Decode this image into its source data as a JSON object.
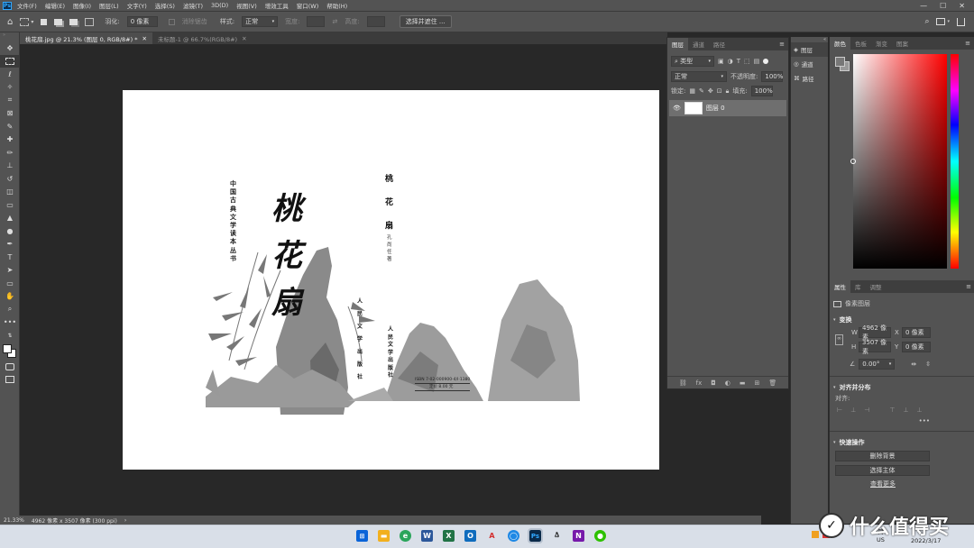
{
  "app": {
    "logo": "Ps"
  },
  "menu": [
    "文件(F)",
    "编辑(E)",
    "图像(I)",
    "图层(L)",
    "文字(Y)",
    "选择(S)",
    "滤镜(T)",
    "3D(D)",
    "视图(V)",
    "增效工具",
    "窗口(W)",
    "帮助(H)"
  ],
  "options": {
    "feather_label": "羽化:",
    "feather_value": "0 像素",
    "antialias_label": "消除锯齿",
    "style_label": "样式:",
    "style_value": "正常",
    "width_label": "宽度:",
    "height_label": "高度:",
    "select_mask_btn": "选择并遮住 ..."
  },
  "tabs": [
    {
      "label": "桃花扇.jpg @ 21.3% (图层 0, RGB/8#) *"
    },
    {
      "label": "未标题-1 @ 66.7%(RGB/8#)"
    }
  ],
  "document": {
    "series": "中国古典文学读本丛书",
    "title_calligraphy": [
      "桃",
      "花",
      "扇"
    ],
    "title_small": [
      "桃",
      "花",
      "扇"
    ],
    "author": "孔尚任著",
    "publisher_v1": "人民文学出版社",
    "publisher_v2": "人民文学出版社",
    "isbn": "ISBN 7-02-000900-4/I·1380",
    "price": "定价 8.00 元"
  },
  "status": {
    "zoom": "21.33%",
    "info": "4962 像素 x 3507 像素 (300 ppi)"
  },
  "layers_panel": {
    "tabs": [
      "图层",
      "通道",
      "路径"
    ],
    "kind_label": "类型",
    "blend_mode": "正常",
    "opacity_label": "不透明度:",
    "opacity_value": "100%",
    "lock_label": "锁定:",
    "fill_label": "填充:",
    "fill_value": "100%",
    "layer_name": "图层 0"
  },
  "dock_buttons": [
    "图层",
    "通道",
    "路径"
  ],
  "color_panel": {
    "tabs": [
      "颜色",
      "色板",
      "渐变",
      "图案"
    ]
  },
  "properties_panel": {
    "tabs": [
      "属性",
      "库",
      "调整"
    ],
    "kind": "像素图层",
    "transform_title": "变换",
    "w_label": "W",
    "w_value": "4962 像素",
    "x_label": "X",
    "x_value": "0 像素",
    "h_label": "H",
    "h_value": "3507 像素",
    "y_label": "Y",
    "y_value": "0 像素",
    "angle_value": "0.00°",
    "align_title": "对齐并分布",
    "align_label": "对齐:",
    "more": "•••",
    "quick_title": "快速操作",
    "remove_bg": "删除背景",
    "select_subject": "选择主体",
    "view_more": "查看更多"
  },
  "taskbar": {
    "lang_top": "简",
    "lang_bottom": "US",
    "date": "2022/3/17",
    "watermark": "什么值得买"
  }
}
